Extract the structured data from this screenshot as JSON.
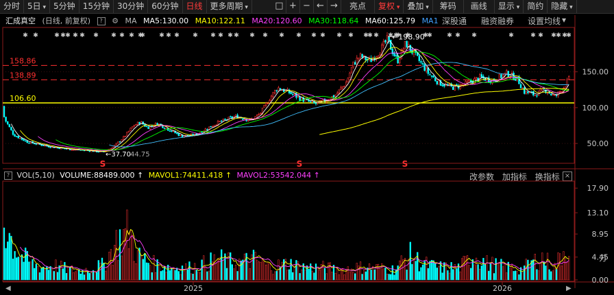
{
  "toolbar": {
    "tabs": [
      "分时",
      "5日",
      "5分钟",
      "15分钟",
      "30分钟",
      "60分钟",
      "日线",
      "更多周期"
    ],
    "active_tab": "日线",
    "tools": [
      "□",
      "+",
      "−",
      "←",
      "→"
    ],
    "right_tabs": [
      "亮点",
      "复权",
      "叠加",
      "筹码",
      "画线",
      "显示",
      "简约",
      "隐藏"
    ]
  },
  "info": {
    "name": "汇成真空",
    "mode": "(日线, 前复权)",
    "ma_label": "MA",
    "ma5": "MA5:130.00",
    "ma10": "MA10:122.11",
    "ma20": "MA20:120.60",
    "ma30": "MA30:118.64",
    "ma60": "MA60:125.79",
    "ma1": "MA1",
    "ma_colors": {
      "ma5": "#ffffff",
      "ma10": "#ffff00",
      "ma20": "#ff40ff",
      "ma30": "#00ff00",
      "ma60": "#ffffff",
      "ma1": "#40a0ff"
    },
    "links": [
      "深股通",
      "融资融券",
      "设置均线"
    ]
  },
  "price_axis": {
    "ticks": [
      "150.00",
      "100.00",
      "50.00"
    ]
  },
  "levels": [
    {
      "label": "158.86",
      "value": 158.86,
      "color": "#ff3030",
      "dashed": true
    },
    {
      "label": "138.89",
      "value": 138.89,
      "color": "#ff3030",
      "dashed": true
    },
    {
      "label": "106.60",
      "value": 106.6,
      "color": "#ffff00",
      "dashed": false
    }
  ],
  "annotations": {
    "high": "198.90",
    "low": "37.70",
    "low2": "44.75",
    "marker": "S"
  },
  "volume": {
    "label": "VOL(5,10)",
    "volume": "VOLUME:88489.000",
    "mavol1": "MAVOL1:74411.418",
    "mavol2": "MAVOL2:53542.044",
    "links": [
      "改参数",
      "加指标",
      "换指标"
    ],
    "ticks": [
      "17.90",
      "13.10",
      "8.95",
      "4.45",
      "0.00"
    ],
    "unit": "万"
  },
  "time_axis": {
    "labels": [
      "2025",
      "2026"
    ]
  },
  "colors": {
    "up": "#ff3232",
    "down": "#00ffff",
    "bg": "#000000"
  },
  "chart_data": {
    "type": "candlestick",
    "series_summary": "Daily price: ~100 in early period, bottoming near 37.70, rising to peak 198.90, settling ~130",
    "ylim_price": [
      30,
      210
    ],
    "ylim_volume": [
      0,
      19
    ],
    "price_path": [
      [
        0,
        102
      ],
      [
        8,
        82
      ],
      [
        20,
        62
      ],
      [
        40,
        52
      ],
      [
        70,
        46
      ],
      [
        100,
        42
      ],
      [
        130,
        40
      ],
      [
        150,
        38
      ],
      [
        165,
        45
      ],
      [
        180,
        58
      ],
      [
        195,
        75
      ],
      [
        205,
        80
      ],
      [
        215,
        72
      ],
      [
        230,
        78
      ],
      [
        245,
        70
      ],
      [
        265,
        60
      ],
      [
        285,
        62
      ],
      [
        300,
        70
      ],
      [
        320,
        80
      ],
      [
        345,
        88
      ],
      [
        365,
        82
      ],
      [
        380,
        92
      ],
      [
        395,
        115
      ],
      [
        405,
        128
      ],
      [
        420,
        122
      ],
      [
        440,
        112
      ],
      [
        460,
        105
      ],
      [
        475,
        110
      ],
      [
        490,
        118
      ],
      [
        505,
        135
      ],
      [
        515,
        160
      ],
      [
        525,
        172
      ],
      [
        540,
        165
      ],
      [
        555,
        180
      ],
      [
        565,
        195
      ],
      [
        572,
        180
      ],
      [
        580,
        165
      ],
      [
        592,
        190
      ],
      [
        600,
        180
      ],
      [
        612,
        165
      ],
      [
        625,
        148
      ],
      [
        640,
        135
      ],
      [
        660,
        128
      ],
      [
        680,
        133
      ],
      [
        700,
        142
      ],
      [
        720,
        138
      ],
      [
        740,
        148
      ],
      [
        755,
        140
      ],
      [
        765,
        122
      ],
      [
        780,
        118
      ],
      [
        795,
        125
      ],
      [
        810,
        115
      ],
      [
        822,
        128
      ],
      [
        832,
        142
      ]
    ],
    "volume_envelope": [
      [
        2,
        15
      ],
      [
        10,
        13
      ],
      [
        18,
        9
      ],
      [
        30,
        6
      ],
      [
        45,
        4
      ],
      [
        60,
        3
      ],
      [
        80,
        3.5
      ],
      [
        100,
        2.5
      ],
      [
        120,
        2.2
      ],
      [
        150,
        3.5
      ],
      [
        170,
        9
      ],
      [
        188,
        12
      ],
      [
        200,
        6
      ],
      [
        220,
        4
      ],
      [
        250,
        3
      ],
      [
        280,
        3
      ],
      [
        300,
        4
      ],
      [
        320,
        5
      ],
      [
        345,
        4
      ],
      [
        370,
        5
      ],
      [
        395,
        3
      ],
      [
        420,
        4
      ],
      [
        445,
        3
      ],
      [
        470,
        3
      ],
      [
        500,
        2.5
      ],
      [
        520,
        3
      ],
      [
        545,
        3
      ],
      [
        575,
        2.5
      ],
      [
        598,
        6
      ],
      [
        615,
        4
      ],
      [
        640,
        3
      ],
      [
        670,
        3
      ],
      [
        693,
        6
      ],
      [
        710,
        4
      ],
      [
        740,
        3
      ],
      [
        760,
        2.5
      ],
      [
        790,
        5.5
      ],
      [
        810,
        3
      ],
      [
        826,
        8.5
      ],
      [
        832,
        7
      ]
    ]
  }
}
